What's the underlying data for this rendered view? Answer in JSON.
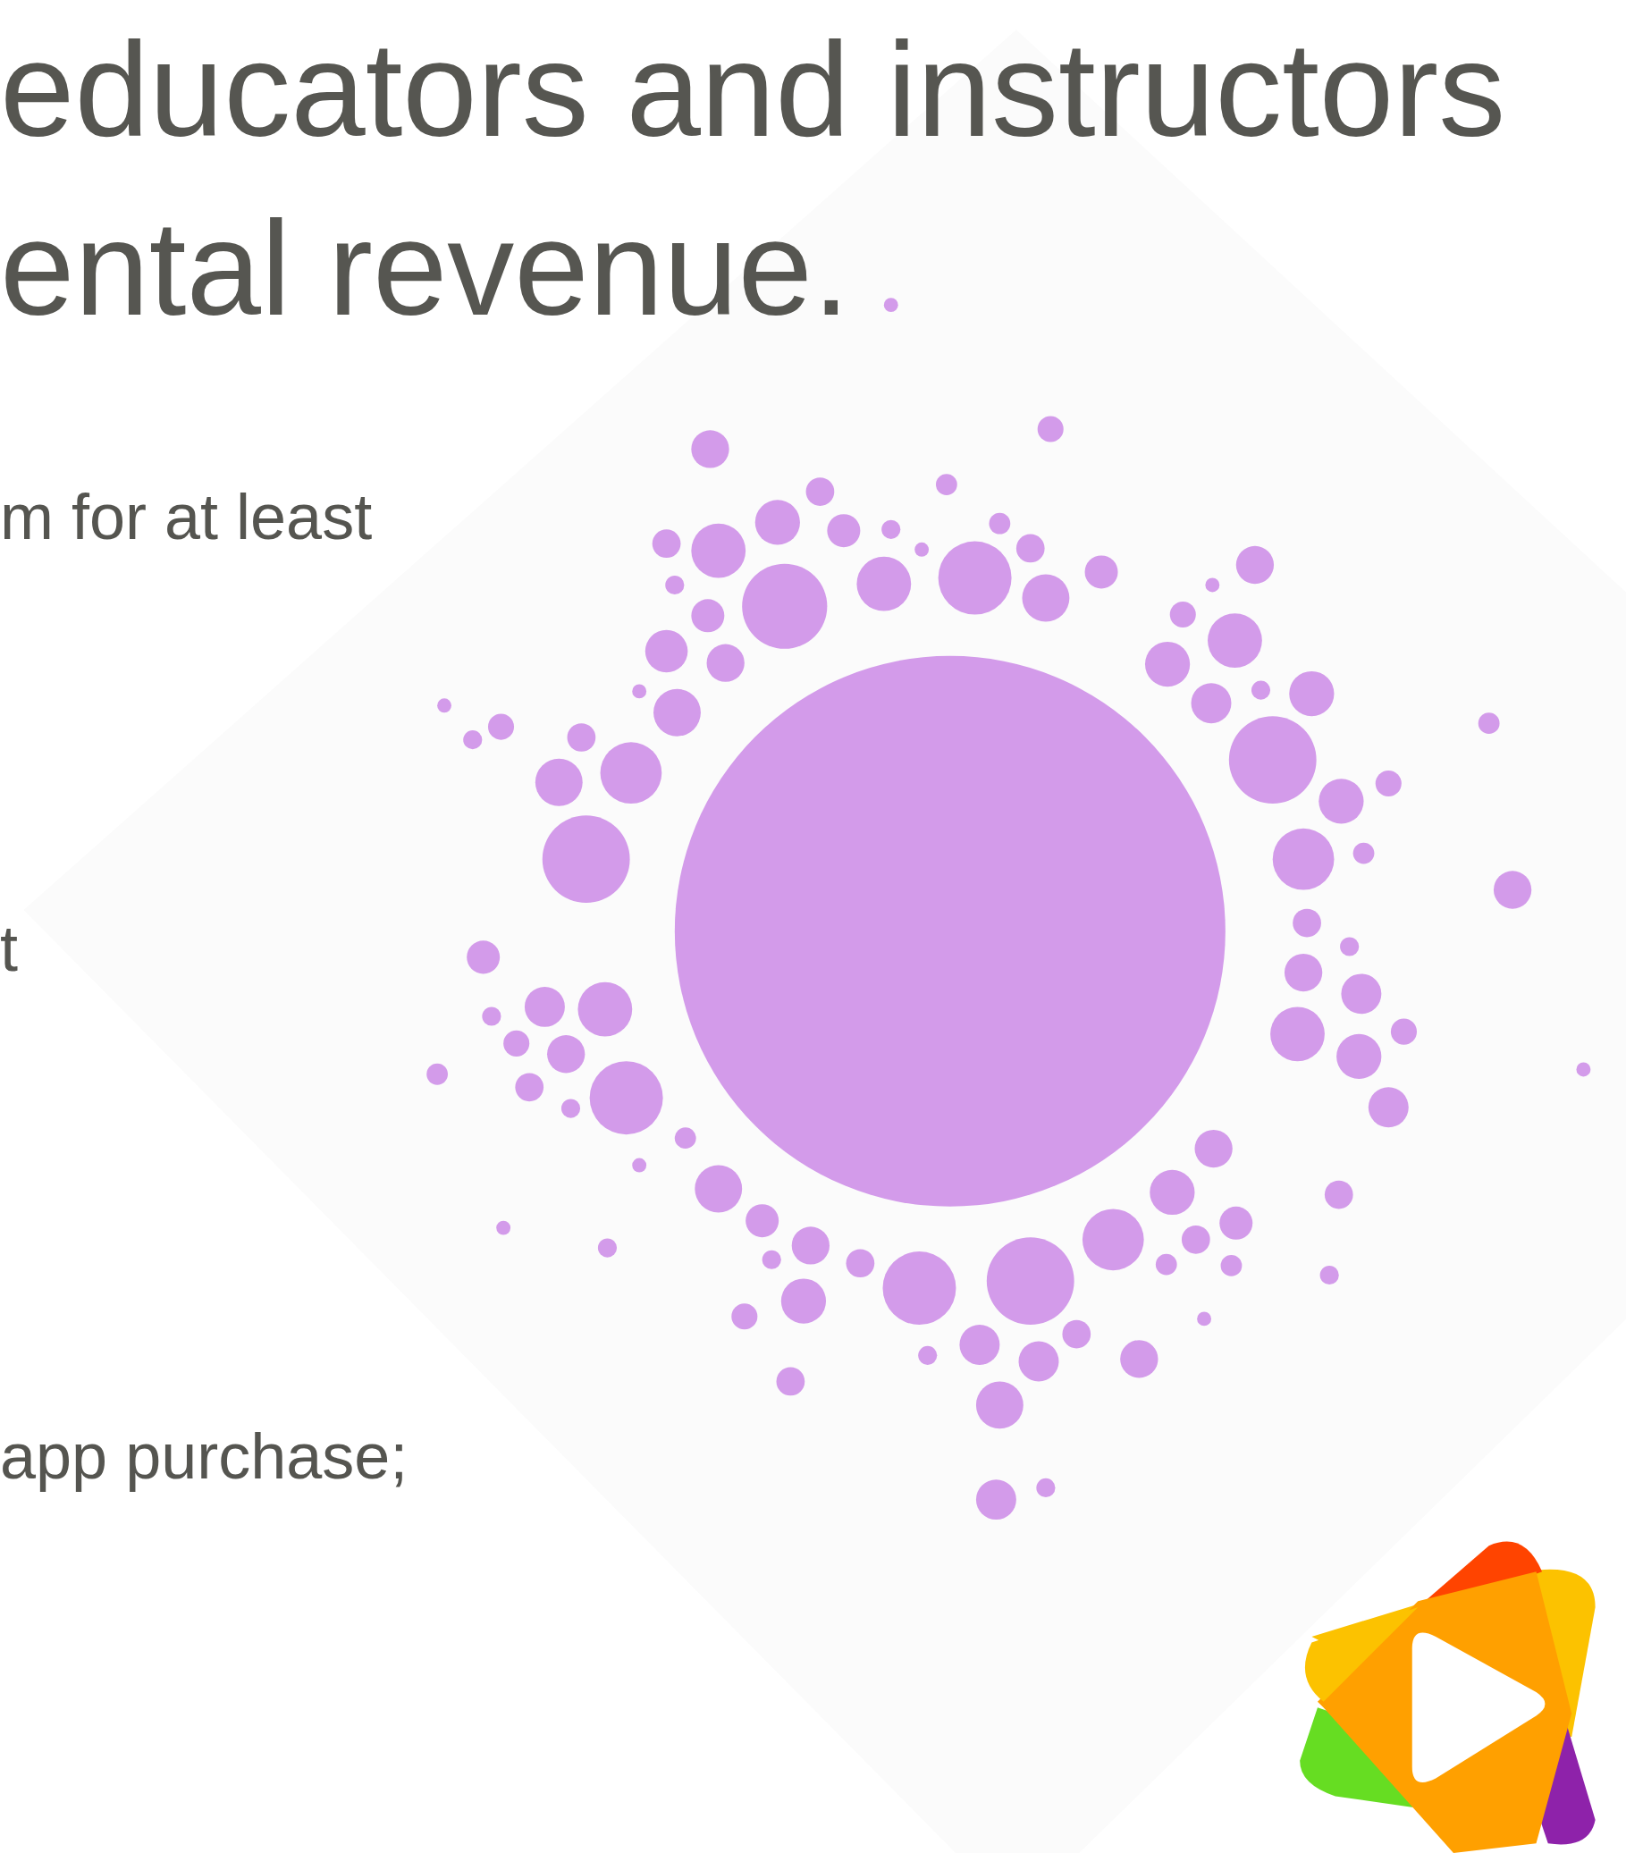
{
  "heading": {
    "lines": [
      "educators and instructors",
      "ental revenue."
    ]
  },
  "body_lines": [
    "m for at least",
    "t",
    "app purchase;"
  ]
}
